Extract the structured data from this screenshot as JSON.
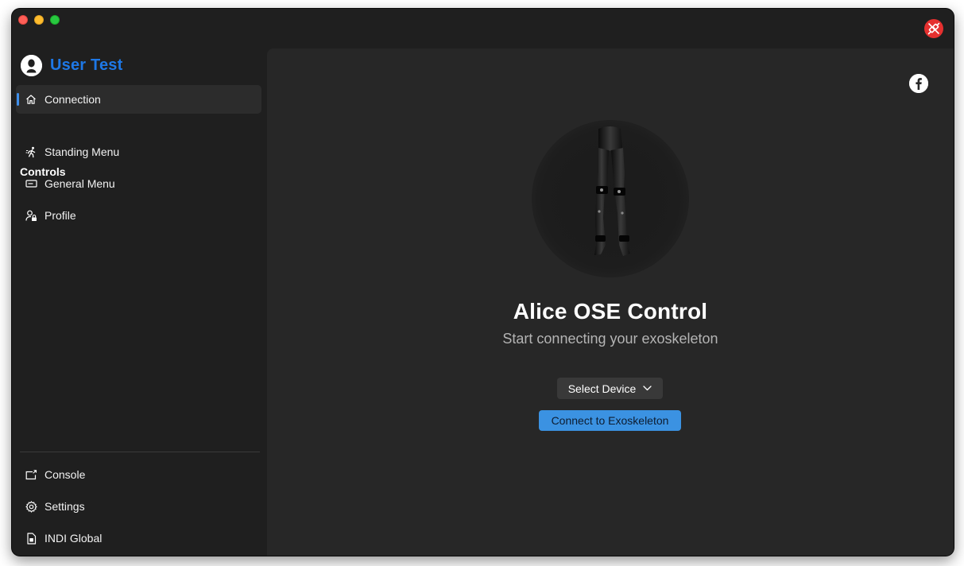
{
  "window": {
    "traffic_lights": [
      "close",
      "minimize",
      "maximize"
    ],
    "status_icon": "plug-disconnected-icon"
  },
  "sidebar": {
    "user": {
      "name": "User Test",
      "icon": "user-avatar-icon",
      "accent": "#1e78e6"
    },
    "primary_items": [
      {
        "label": "Connection",
        "icon": "home-icon",
        "selected": true
      }
    ],
    "controls_heading": "Controls",
    "control_items": [
      {
        "label": "Standing Menu",
        "icon": "walking-figure-icon"
      },
      {
        "label": "General Menu",
        "icon": "card-icon"
      },
      {
        "label": "Profile",
        "icon": "person-lock-icon"
      }
    ],
    "footer_items": [
      {
        "label": "Console",
        "icon": "console-window-icon"
      },
      {
        "label": "Settings",
        "icon": "gear-icon"
      },
      {
        "label": "INDI Global",
        "icon": "document-icon"
      }
    ]
  },
  "main": {
    "social_icon": "facebook-icon",
    "title": "Alice OSE Control",
    "subtitle": "Start connecting your exoskeleton",
    "device_select": {
      "label": "Select Device",
      "icon": "chevron-down-icon"
    },
    "connect_button": {
      "label": "Connect to Exoskeleton",
      "color": "#3b92e2"
    }
  },
  "colors": {
    "window_bg": "#1f1f1f",
    "content_bg": "#272727",
    "selection_indicator": "#3f8fea",
    "disconnected_red": "#e5302f"
  }
}
